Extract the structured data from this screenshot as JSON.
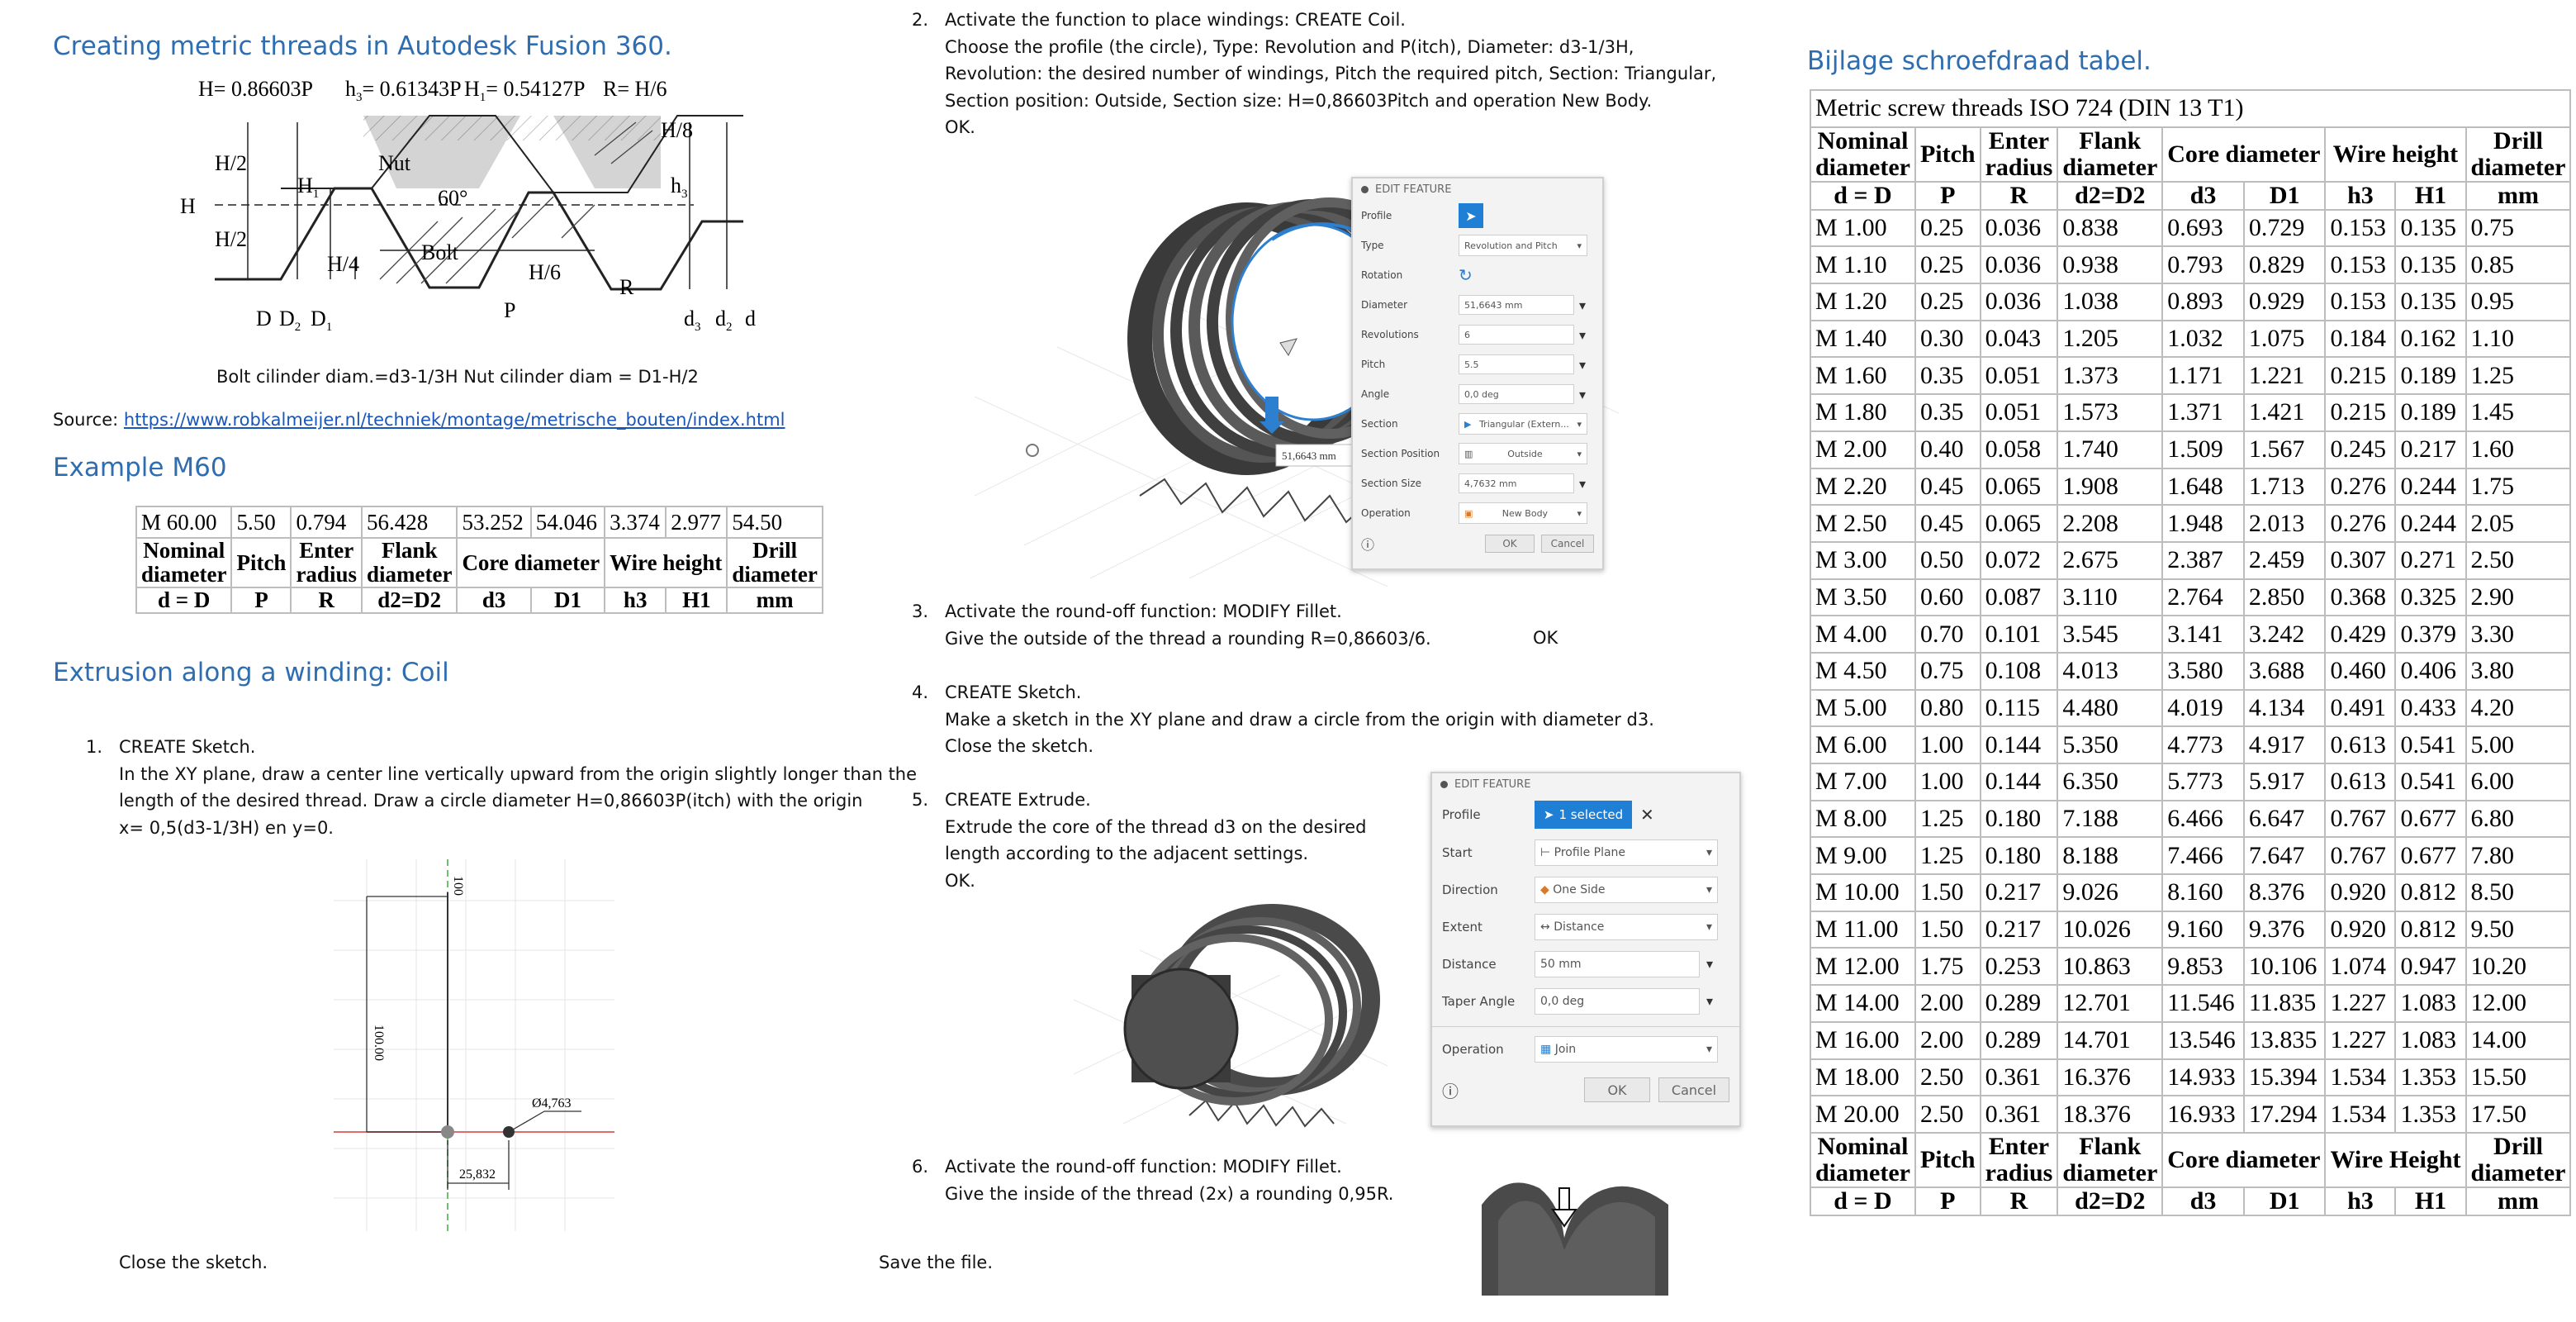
{
  "left": {
    "title": "Creating metric threads in Autodesk Fusion 360.",
    "formula": {
      "f1": "H= 0.86603P",
      "f2": "h",
      "f2sub": "3",
      "f2val": "= 0.61343P",
      "f3": "H",
      "f3sub": "1",
      "f3val": "= 0.54127P",
      "f4": "R= H/6"
    },
    "diagram_labels": {
      "h8": "H/8",
      "h2a": "H/2",
      "h2b": "H/2",
      "H": "H",
      "H1": "H",
      "H1sub": "1",
      "nut": "Nut",
      "angle": "60°",
      "h3": "h",
      "h3sub": "3",
      "h4": "H/4",
      "bolt": "Bolt",
      "h6": "H/6",
      "R": "R",
      "P": "P",
      "D": "D",
      "D2": "D",
      "D2sub": "2",
      "D1": "D",
      "D1sub": "1",
      "d3": "d",
      "d3sub": "3",
      "d2": "d",
      "d2sub": "2",
      "d": "d"
    },
    "cylinder_note": "Bolt cilinder diam.=d3-1/3H    Nut cilinder diam = D1-H/2",
    "source_label": "Source: ",
    "source_url": "https://www.robkalmeijer.nl/techniek/montage/metrische_bouten/index.html",
    "example_heading": "Example M60",
    "example_table": {
      "values": [
        "M 60.00",
        "5.50",
        "0.794",
        "56.428",
        "53.252",
        "54.046",
        "3.374",
        "2.977",
        "54.50"
      ],
      "headers": {
        "nominal": [
          "Nominal",
          "diameter"
        ],
        "pitch": "Pitch",
        "enter": [
          "Enter",
          "radius"
        ],
        "flank": [
          "Flank",
          "diameter"
        ],
        "core": "Core diameter",
        "wire": "Wire height",
        "drill": [
          "Drill",
          "diameter"
        ]
      },
      "symbols": [
        "d = D",
        "P",
        "R",
        "d2=D2",
        "d3",
        "D1",
        "h3",
        "H1",
        "mm"
      ]
    },
    "coil_heading": "Extrusion along a winding: Coil",
    "step1": {
      "num": "1.",
      "lines": [
        "CREATE Sketch.",
        "In the XY plane, draw a center line vertically upward from the origin slightly longer than the",
        "length of the desired thread. Draw a circle diameter H=0,86603P(itch) with the origin",
        "x= 0,5(d3-1/3H) en y=0."
      ]
    },
    "sketch_labels": {
      "dim_vertical": "100.00",
      "dim_top": "100",
      "dim_circle": "Ø4,763",
      "dim_horizontal": "25,832"
    },
    "close_sketch": "Close the sketch."
  },
  "middle": {
    "step2": {
      "num": "2.",
      "lines": [
        "Activate the function to place windings: CREATE Coil.",
        "Choose the profile (the circle), Type: Revolution and P(itch), Diameter: d3-1/3H,",
        "Revolution: the desired number of windings, Pitch the required pitch, Section: Triangular,",
        "Section position: Outside, Section size: H=0,86603Pitch and operation New Body.",
        "OK."
      ]
    },
    "coil_panel": {
      "title": "EDIT FEATURE",
      "rows": [
        {
          "label": "Profile",
          "value": ""
        },
        {
          "label": "Type",
          "value": "Revolution and Pitch"
        },
        {
          "label": "Rotation",
          "value": ""
        },
        {
          "label": "Diameter",
          "value": "51,6643 mm"
        },
        {
          "label": "Revolutions",
          "value": "6"
        },
        {
          "label": "Pitch",
          "value": "5.5"
        },
        {
          "label": "Angle",
          "value": "0,0 deg"
        },
        {
          "label": "Section",
          "value": "Triangular (Extern..."
        },
        {
          "label": "Section Position",
          "value": "Outside"
        },
        {
          "label": "Section Size",
          "value": "4,7632 mm"
        },
        {
          "label": "Operation",
          "value": "New Body"
        }
      ],
      "ok": "OK",
      "cancel": "Cancel"
    },
    "coil_view_dim": "51,6643 mm",
    "step3": {
      "num": "3.",
      "lines": [
        "Activate the round-off function: MODIFY Fillet.",
        "Give the outside of the thread a rounding R=0,86603/6."
      ],
      "ok": "OK"
    },
    "step4": {
      "num": "4.",
      "lines": [
        "CREATE Sketch.",
        "Make a sketch in the XY plane  and draw a circle from the origin with diameter d3.",
        "Close the sketch."
      ]
    },
    "step5": {
      "num": "5.",
      "lines": [
        "CREATE Extrude.",
        "Extrude the core of the thread d3 on the desired",
        "length according to the adjacent settings.",
        "OK."
      ]
    },
    "extrude_panel": {
      "title": "EDIT FEATURE",
      "rows": [
        {
          "label": "Profile",
          "value": "1 selected"
        },
        {
          "label": "Start",
          "value": "Profile Plane"
        },
        {
          "label": "Direction",
          "value": "One Side"
        },
        {
          "label": "Extent",
          "value": "Distance"
        },
        {
          "label": "Distance",
          "value": "50 mm"
        },
        {
          "label": "Taper Angle",
          "value": "0,0 deg"
        },
        {
          "label": "Operation",
          "value": "Join"
        }
      ],
      "ok": "OK",
      "cancel": "Cancel"
    },
    "step6": {
      "num": "6.",
      "lines": [
        "Activate the round-off function: MODIFY Fillet.",
        "Give the inside of the thread  (2x) a rounding 0,95R."
      ]
    },
    "save": "Save the file."
  },
  "right": {
    "heading": "Bijlage schroefdraad tabel.",
    "table_title": "Metric screw threads ISO 724 (DIN 13 T1)",
    "headers_top": {
      "nominal": [
        "Nominal",
        "diameter"
      ],
      "pitch": "Pitch",
      "enter": [
        "Enter",
        "radius"
      ],
      "flank": [
        "Flank",
        "diameter"
      ],
      "core": "Core diameter",
      "wire": "Wire height",
      "drill": [
        "Drill",
        "diameter"
      ]
    },
    "headers_bottom": {
      "nominal": [
        "Nominal",
        "diameter"
      ],
      "pitch": "Pitch",
      "enter": [
        "Enter",
        "radius"
      ],
      "flank": [
        "Flank",
        "diameter"
      ],
      "core": "Core diameter",
      "wire": "Wire Height",
      "drill": [
        "Drill",
        "diameter"
      ]
    },
    "symbols": [
      "d = D",
      "P",
      "R",
      "d2=D2",
      "d3",
      "D1",
      "h3",
      "H1",
      "mm"
    ],
    "rows": [
      [
        "M 1.00",
        "0.25",
        "0.036",
        "0.838",
        "0.693",
        "0.729",
        "0.153",
        "0.135",
        "0.75"
      ],
      [
        "M 1.10",
        "0.25",
        "0.036",
        "0.938",
        "0.793",
        "0.829",
        "0.153",
        "0.135",
        "0.85"
      ],
      [
        "M 1.20",
        "0.25",
        "0.036",
        "1.038",
        "0.893",
        "0.929",
        "0.153",
        "0.135",
        "0.95"
      ],
      [
        "M 1.40",
        "0.30",
        "0.043",
        "1.205",
        "1.032",
        "1.075",
        "0.184",
        "0.162",
        "1.10"
      ],
      [
        "M 1.60",
        "0.35",
        "0.051",
        "1.373",
        "1.171",
        "1.221",
        "0.215",
        "0.189",
        "1.25"
      ],
      [
        "M 1.80",
        "0.35",
        "0.051",
        "1.573",
        "1.371",
        "1.421",
        "0.215",
        "0.189",
        "1.45"
      ],
      [
        "M 2.00",
        "0.40",
        "0.058",
        "1.740",
        "1.509",
        "1.567",
        "0.245",
        "0.217",
        "1.60"
      ],
      [
        "M 2.20",
        "0.45",
        "0.065",
        "1.908",
        "1.648",
        "1.713",
        "0.276",
        "0.244",
        "1.75"
      ],
      [
        "M 2.50",
        "0.45",
        "0.065",
        "2.208",
        "1.948",
        "2.013",
        "0.276",
        "0.244",
        "2.05"
      ],
      [
        "M 3.00",
        "0.50",
        "0.072",
        "2.675",
        "2.387",
        "2.459",
        "0.307",
        "0.271",
        "2.50"
      ],
      [
        "M 3.50",
        "0.60",
        "0.087",
        "3.110",
        "2.764",
        "2.850",
        "0.368",
        "0.325",
        "2.90"
      ],
      [
        "M 4.00",
        "0.70",
        "0.101",
        "3.545",
        "3.141",
        "3.242",
        "0.429",
        "0.379",
        "3.30"
      ],
      [
        "M 4.50",
        "0.75",
        "0.108",
        "4.013",
        "3.580",
        "3.688",
        "0.460",
        "0.406",
        "3.80"
      ],
      [
        "M 5.00",
        "0.80",
        "0.115",
        "4.480",
        "4.019",
        "4.134",
        "0.491",
        "0.433",
        "4.20"
      ],
      [
        "M 6.00",
        "1.00",
        "0.144",
        "5.350",
        "4.773",
        "4.917",
        "0.613",
        "0.541",
        "5.00"
      ],
      [
        "M 7.00",
        "1.00",
        "0.144",
        "6.350",
        "5.773",
        "5.917",
        "0.613",
        "0.541",
        "6.00"
      ],
      [
        "M 8.00",
        "1.25",
        "0.180",
        "7.188",
        "6.466",
        "6.647",
        "0.767",
        "0.677",
        "6.80"
      ],
      [
        "M 9.00",
        "1.25",
        "0.180",
        "8.188",
        "7.466",
        "7.647",
        "0.767",
        "0.677",
        "7.80"
      ],
      [
        "M 10.00",
        "1.50",
        "0.217",
        "9.026",
        "8.160",
        "8.376",
        "0.920",
        "0.812",
        "8.50"
      ],
      [
        "M 11.00",
        "1.50",
        "0.217",
        "10.026",
        "9.160",
        "9.376",
        "0.920",
        "0.812",
        "9.50"
      ],
      [
        "M 12.00",
        "1.75",
        "0.253",
        "10.863",
        "9.853",
        "10.106",
        "1.074",
        "0.947",
        "10.20"
      ],
      [
        "M 14.00",
        "2.00",
        "0.289",
        "12.701",
        "11.546",
        "11.835",
        "1.227",
        "1.083",
        "12.00"
      ],
      [
        "M 16.00",
        "2.00",
        "0.289",
        "14.701",
        "13.546",
        "13.835",
        "1.227",
        "1.083",
        "14.00"
      ],
      [
        "M 18.00",
        "2.50",
        "0.361",
        "16.376",
        "14.933",
        "15.394",
        "1.534",
        "1.353",
        "15.50"
      ],
      [
        "M 20.00",
        "2.50",
        "0.361",
        "18.376",
        "16.933",
        "17.294",
        "1.534",
        "1.353",
        "17.50"
      ]
    ]
  }
}
